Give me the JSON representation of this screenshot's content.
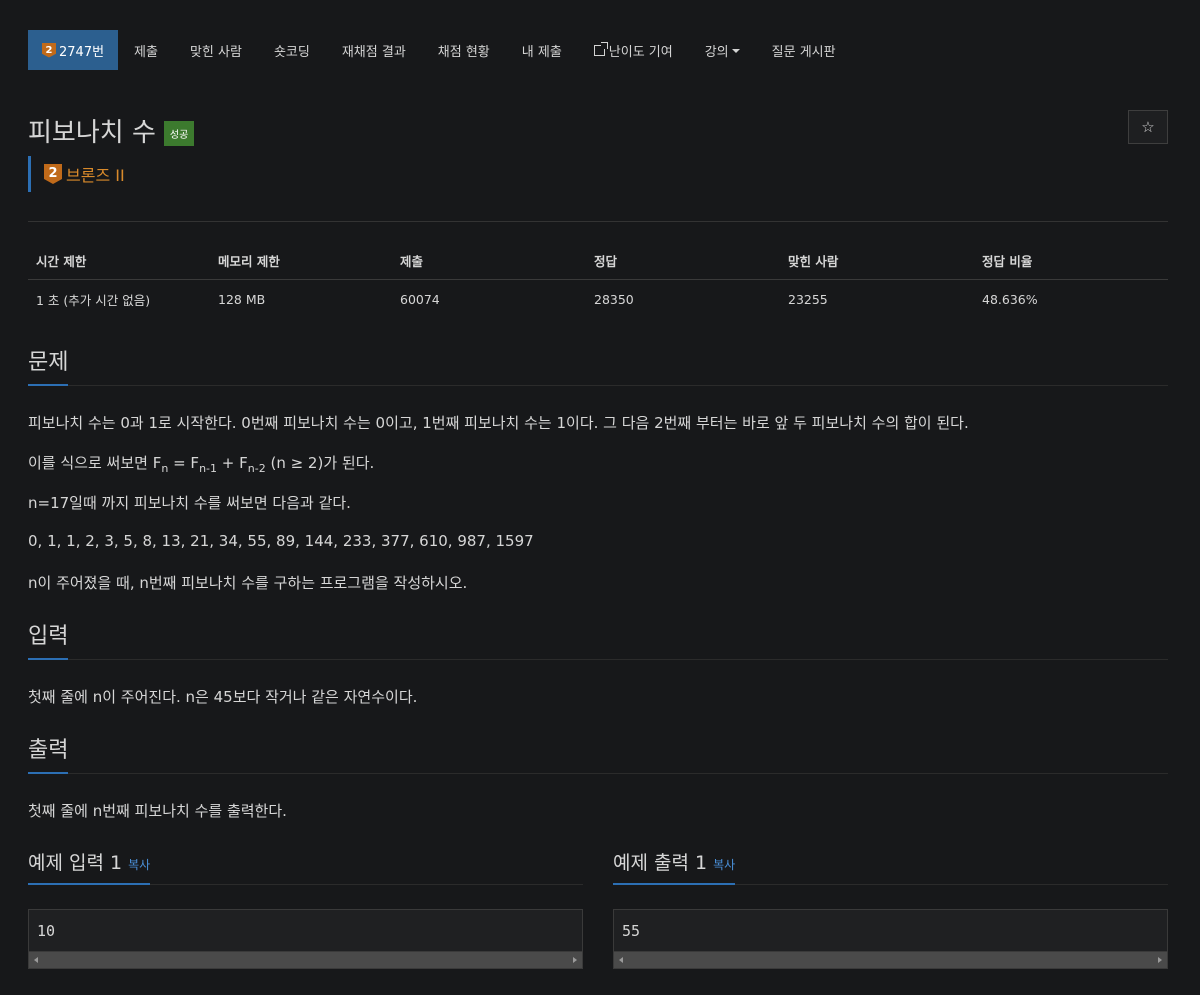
{
  "nav": {
    "problem_id": "2747번",
    "tier_number": "2",
    "items": [
      "제출",
      "맞힌 사람",
      "숏코딩",
      "재채점 결과",
      "채점 현황",
      "내 제출",
      "난이도 기여",
      "강의",
      "질문 게시판"
    ]
  },
  "problem": {
    "title": "피보나치 수",
    "status": "성공",
    "star": "☆",
    "tier_number": "2",
    "tier_label": "브론즈 II"
  },
  "info_table": {
    "headers": [
      "시간 제한",
      "메모리 제한",
      "제출",
      "정답",
      "맞힌 사람",
      "정답 비율"
    ],
    "row": [
      "1 초 (추가 시간 없음)",
      "128 MB",
      "60074",
      "28350",
      "23255",
      "48.636%"
    ]
  },
  "description": {
    "heading": "문제",
    "line1": "피보나치 수는 0과 1로 시작한다. 0번째 피보나치 수는 0이고, 1번째 피보나치 수는 1이다. 그 다음 2번째 부터는 바로 앞 두 피보나치 수의 합이 된다.",
    "line2_prefix": "이를 식으로 써보면 F",
    "line2_sub1": "n",
    "line2_mid1": " = F",
    "line2_sub2": "n-1",
    "line2_mid2": " + F",
    "line2_sub3": "n-2",
    "line2_suffix": " (n ≥ 2)가 된다.",
    "line3": "n=17일때 까지 피보나치 수를 써보면 다음과 같다.",
    "line4": "0, 1, 1, 2, 3, 5, 8, 13, 21, 34, 55, 89, 144, 233, 377, 610, 987, 1597",
    "line5": "n이 주어졌을 때, n번째 피보나치 수를 구하는 프로그램을 작성하시오."
  },
  "input": {
    "heading": "입력",
    "text": "첫째 줄에 n이 주어진다. n은 45보다 작거나 같은 자연수이다."
  },
  "output": {
    "heading": "출력",
    "text": "첫째 줄에 n번째 피보나치 수를 출력한다."
  },
  "samples": {
    "input_heading": "예제 입력 1",
    "output_heading": "예제 출력 1",
    "copy_label": "복사",
    "input_value": "10",
    "output_value": "55"
  }
}
